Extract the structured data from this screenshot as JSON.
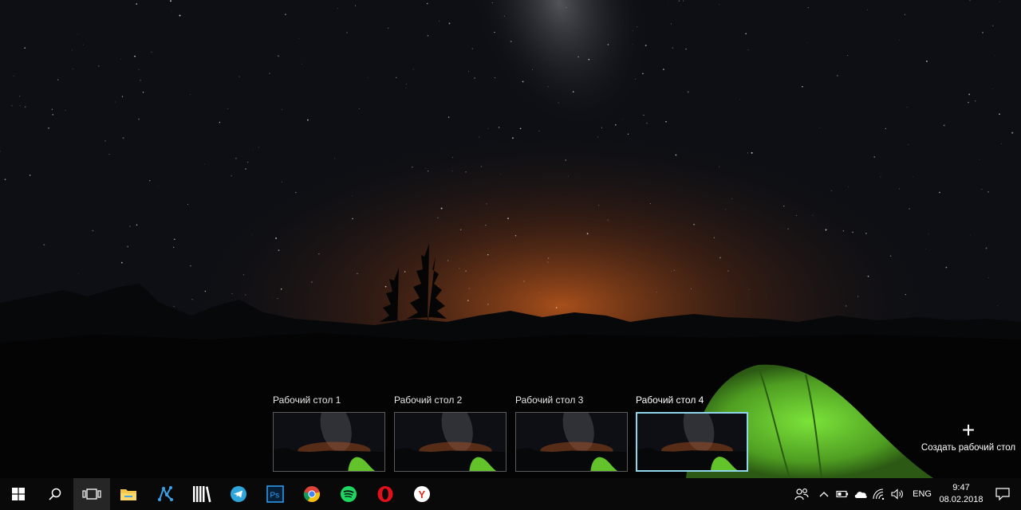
{
  "desktops": [
    {
      "label": "Рабочий стол 1",
      "active": false
    },
    {
      "label": "Рабочий стол 2",
      "active": false
    },
    {
      "label": "Рабочий стол 3",
      "active": false
    },
    {
      "label": "Рабочий стол 4",
      "active": true
    }
  ],
  "new_desktop": {
    "label": "Создать рабочий стол"
  },
  "taskbar": {
    "apps": [
      {
        "name": "start-icon"
      },
      {
        "name": "search-icon"
      },
      {
        "name": "task-view-icon",
        "pressed": true
      },
      {
        "name": "file-explorer-icon"
      },
      {
        "name": "network-app-icon"
      },
      {
        "name": "library-icon"
      },
      {
        "name": "telegram-icon"
      },
      {
        "name": "photoshop-icon",
        "text": "Ps"
      },
      {
        "name": "chrome-icon"
      },
      {
        "name": "spotify-icon"
      },
      {
        "name": "opera-icon"
      },
      {
        "name": "yandex-browser-icon",
        "text": "Y"
      }
    ],
    "tray": {
      "language": "ENG",
      "time": "9:47",
      "date": "08.02.2018"
    }
  },
  "colors": {
    "sky": "#0c0e14",
    "horizon_glow": "#b4521c",
    "tent": "#62c42a",
    "active_border": "#8fd6ec"
  }
}
